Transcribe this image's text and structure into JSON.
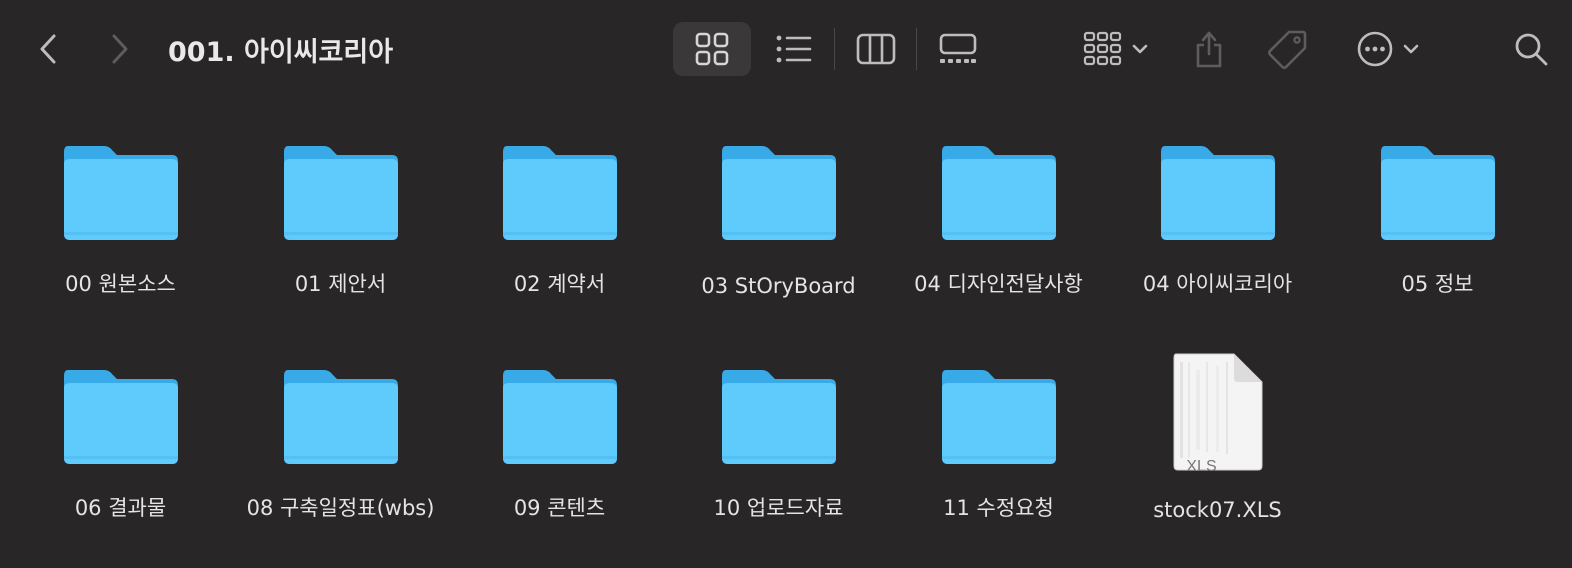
{
  "window": {
    "title": "001. 아이씨코리아"
  },
  "toolbar": {
    "back_icon": "chevron-left-icon",
    "forward_icon": "chevron-right-icon",
    "views": [
      "icon-view",
      "list-view",
      "column-view",
      "gallery-view"
    ],
    "active_view": "icon-view",
    "group_icon": "group-grid-icon",
    "share_icon": "share-icon",
    "tag_icon": "tag-icon",
    "more_icon": "ellipsis-circle-icon",
    "search_icon": "search-icon"
  },
  "colors": {
    "background": "#282627",
    "folder_front": "#5ecbfc",
    "folder_back": "#38aae8",
    "text": "#e4e4e4"
  },
  "items": [
    {
      "name": "00 원본소스",
      "kind": "folder"
    },
    {
      "name": "01 제안서",
      "kind": "folder"
    },
    {
      "name": "02 계약서",
      "kind": "folder"
    },
    {
      "name": "03 StOryBoard",
      "kind": "folder"
    },
    {
      "name": "04 디자인전달사항",
      "kind": "folder"
    },
    {
      "name": "04 아이씨코리아",
      "kind": "folder"
    },
    {
      "name": "05 정보",
      "kind": "folder"
    },
    {
      "name": "06 결과물",
      "kind": "folder"
    },
    {
      "name": "08 구축일정표(wbs)",
      "kind": "folder"
    },
    {
      "name": "09 콘텐츠",
      "kind": "folder"
    },
    {
      "name": "10 업로드자료",
      "kind": "folder"
    },
    {
      "name": "11 수정요청",
      "kind": "folder"
    },
    {
      "name": "stock07.XLS",
      "kind": "document",
      "ext_label": "XLS"
    }
  ]
}
